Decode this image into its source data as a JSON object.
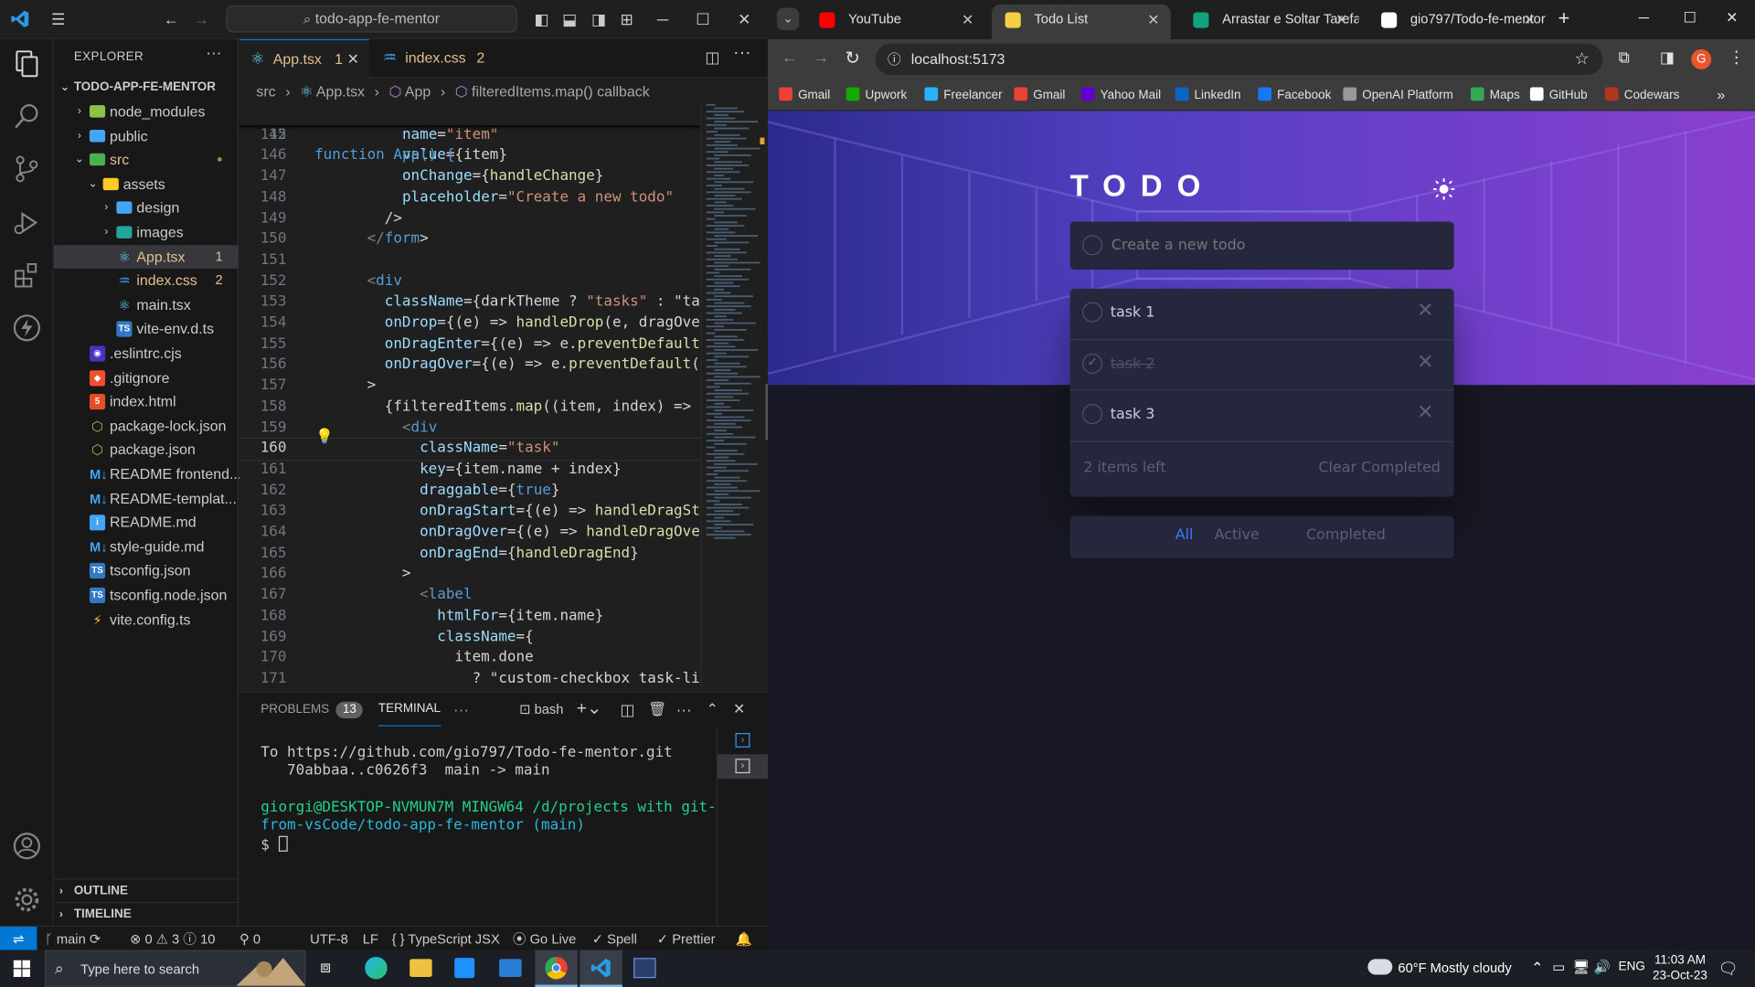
{
  "vscode": {
    "title_search": "todo-app-fe-mentor",
    "explorer_title": "EXPLORER",
    "root_folder": "TODO-APP-FE-MENTOR",
    "tree": [
      {
        "label": "node_modules",
        "kind": "folder",
        "depth": 1,
        "open": false
      },
      {
        "label": "public",
        "kind": "folder",
        "depth": 1,
        "open": false
      },
      {
        "label": "src",
        "kind": "folder",
        "depth": 1,
        "open": true
      },
      {
        "label": "assets",
        "kind": "folder",
        "depth": 2,
        "open": true
      },
      {
        "label": "design",
        "kind": "folder",
        "depth": 3,
        "open": false
      },
      {
        "label": "images",
        "kind": "folder",
        "depth": 3,
        "open": false
      },
      {
        "label": "App.tsx",
        "kind": "react",
        "depth": 3,
        "badge": "1",
        "selected": true
      },
      {
        "label": "index.css",
        "kind": "css",
        "depth": 3,
        "badge": "2"
      },
      {
        "label": "main.tsx",
        "kind": "react",
        "depth": 3
      },
      {
        "label": "vite-env.d.ts",
        "kind": "ts",
        "depth": 3
      },
      {
        "label": ".eslintrc.cjs",
        "kind": "eslint",
        "depth": 1
      },
      {
        "label": ".gitignore",
        "kind": "git",
        "depth": 1
      },
      {
        "label": "index.html",
        "kind": "html",
        "depth": 1
      },
      {
        "label": "package-lock.json",
        "kind": "npm",
        "depth": 1
      },
      {
        "label": "package.json",
        "kind": "npm",
        "depth": 1
      },
      {
        "label": "README frontend...",
        "kind": "md",
        "depth": 1
      },
      {
        "label": "README-templat...",
        "kind": "md",
        "depth": 1
      },
      {
        "label": "README.md",
        "kind": "info",
        "depth": 1
      },
      {
        "label": "style-guide.md",
        "kind": "md",
        "depth": 1
      },
      {
        "label": "tsconfig.json",
        "kind": "ts",
        "depth": 1
      },
      {
        "label": "tsconfig.node.json",
        "kind": "ts",
        "depth": 1
      },
      {
        "label": "vite.config.ts",
        "kind": "vite",
        "depth": 1
      }
    ],
    "outline_label": "OUTLINE",
    "timeline_label": "TIMELINE",
    "tabs": [
      {
        "label": "App.tsx",
        "badge": "1",
        "active": true
      },
      {
        "label": "index.css",
        "badge": "2",
        "active": false
      }
    ],
    "breadcrumbs": [
      "src",
      "App.tsx",
      "App",
      "filteredItems.map() callback"
    ],
    "sticky_line": {
      "num": "12",
      "text": "function App() {"
    },
    "code": [
      {
        "num": "145",
        "text": "          name=\"item\""
      },
      {
        "num": "146",
        "text": "          value={item}"
      },
      {
        "num": "147",
        "text": "          onChange={handleChange}"
      },
      {
        "num": "148",
        "text": "          placeholder=\"Create a new todo\""
      },
      {
        "num": "149",
        "text": "        />"
      },
      {
        "num": "150",
        "text": "      </form>"
      },
      {
        "num": "151",
        "text": ""
      },
      {
        "num": "152",
        "text": "      <div"
      },
      {
        "num": "153",
        "text": "        className={darkTheme ? \"tasks\" : \"ta"
      },
      {
        "num": "154",
        "text": "        onDrop={(e) => handleDrop(e, dragOve"
      },
      {
        "num": "155",
        "text": "        onDragEnter={(e) => e.preventDefault"
      },
      {
        "num": "156",
        "text": "        onDragOver={(e) => e.preventDefault("
      },
      {
        "num": "157",
        "text": "      >"
      },
      {
        "num": "158",
        "text": "        {filteredItems.map((item, index) =>"
      },
      {
        "num": "159",
        "text": "          <div"
      },
      {
        "num": "160",
        "text": "            className=\"task\""
      },
      {
        "num": "161",
        "text": "            key={item.name + index}"
      },
      {
        "num": "162",
        "text": "            draggable={true}"
      },
      {
        "num": "163",
        "text": "            onDragStart={(e) => handleDragSt"
      },
      {
        "num": "164",
        "text": "            onDragOver={(e) => handleDragOve"
      },
      {
        "num": "165",
        "text": "            onDragEnd={handleDragEnd}"
      },
      {
        "num": "166",
        "text": "          >"
      },
      {
        "num": "167",
        "text": "            <label"
      },
      {
        "num": "168",
        "text": "              htmlFor={item.name}"
      },
      {
        "num": "169",
        "text": "              className={"
      },
      {
        "num": "170",
        "text": "                item.done"
      },
      {
        "num": "171",
        "text": "                  ? \"custom-checkbox task-li"
      }
    ],
    "panel": {
      "problems_label": "PROBLEMS",
      "problems_count": "13",
      "terminal_label": "TERMINAL",
      "shell": "bash",
      "lines": [
        "To https://github.com/gio797/Todo-fe-mentor.git",
        "   70abbaa..c0626f3  main -> main",
        "",
        "giorgi@DESKTOP-NVMUN7M MINGW64 /d/projects with git-",
        "from-vsCode/todo-app-fe-mentor (main)",
        "$ "
      ]
    },
    "status": {
      "branch": "main",
      "errors": "0",
      "warnings": "3",
      "infos": "10",
      "ports": "0",
      "encoding": "UTF-8",
      "eol": "LF",
      "language": "TypeScript JSX",
      "golive": "Go Live",
      "spell": "Spell",
      "prettier": "Prettier"
    }
  },
  "browser": {
    "tabs": [
      {
        "label": "YouTube",
        "color": "#ff0000",
        "active": false
      },
      {
        "label": "Todo List",
        "color": "#f5d142",
        "active": true
      },
      {
        "label": "Arrastar e Soltar Tarefas",
        "color": "#10a37f",
        "active": false
      },
      {
        "label": "gio797/Todo-fe-mentor",
        "color": "#ffffff",
        "active": false
      }
    ],
    "url": "localhost:5173",
    "profile_initial": "G",
    "bookmarks": [
      {
        "label": "Gmail",
        "color": "#ea4335"
      },
      {
        "label": "Upwork",
        "color": "#14a800"
      },
      {
        "label": "Freelancer",
        "color": "#29b2fe"
      },
      {
        "label": "Gmail",
        "color": "#ea4335"
      },
      {
        "label": "Yahoo Mail",
        "color": "#6001d2"
      },
      {
        "label": "LinkedIn",
        "color": "#0a66c2"
      },
      {
        "label": "Facebook",
        "color": "#1877f2"
      },
      {
        "label": "OpenAI Platform",
        "color": "#999999"
      },
      {
        "label": "Maps",
        "color": "#34a853"
      },
      {
        "label": "GitHub",
        "color": "#ffffff"
      },
      {
        "label": "Codewars",
        "color": "#b1361e"
      }
    ]
  },
  "todo": {
    "title": "TODO",
    "placeholder": "Create a new todo",
    "tasks": [
      {
        "text": "task 1",
        "done": false
      },
      {
        "text": "task 2",
        "done": true
      },
      {
        "text": "task 3",
        "done": false
      }
    ],
    "items_left": "2 items left",
    "clear_label": "Clear Completed",
    "filters": [
      {
        "label": "All",
        "active": true
      },
      {
        "label": "Active",
        "active": false
      },
      {
        "label": "Completed",
        "active": false
      }
    ]
  },
  "taskbar": {
    "search_placeholder": "Type here to search",
    "weather": "60°F  Mostly cloudy",
    "lang": "ENG",
    "time": "11:03 AM",
    "date": "23-Oct-23"
  }
}
